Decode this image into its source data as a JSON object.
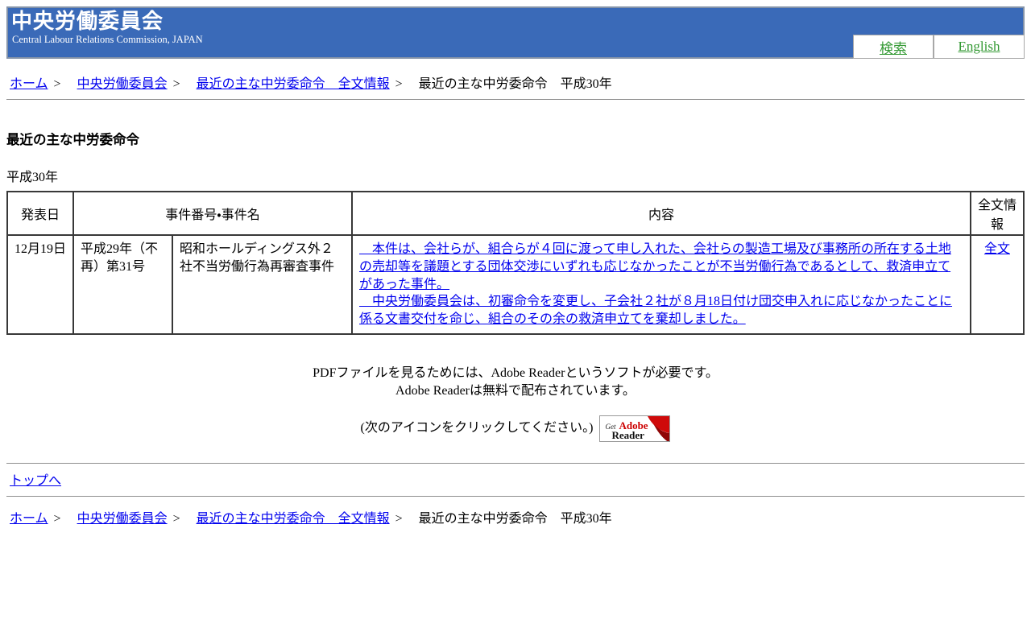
{
  "header": {
    "title": "中央労働委員会",
    "subtitle": "Central Labour Relations Commission, JAPAN",
    "search_label": "検索",
    "english_label": "English"
  },
  "breadcrumb": {
    "separator": ">",
    "items": [
      {
        "label": "ホーム"
      },
      {
        "label": "中央労働委員会"
      },
      {
        "label": "最近の主な中労委命令　全文情報"
      },
      {
        "label": "最近の主な中労委命令　平成30年"
      }
    ]
  },
  "main": {
    "page_title": "最近の主な中労委命令",
    "year_label": "平成30年",
    "table": {
      "headers": {
        "date": "発表日",
        "case": "事件番号・事件名",
        "content": "内容",
        "fulltext": "全文情報"
      },
      "row": {
        "date": "12月19日",
        "case_number": "平成29年（不再）第31号",
        "case_name": "昭和ホールディングス外２社不当労働行為再審査事件",
        "summary_para1": "　本件は、会社らが、組合らが４回に渡って申し入れた、会社らの製造工場及び事務所の所在する土地の売却等を議題とする団体交渉にいずれも応じなかったことが不当労働行為であるとして、救済申立てがあった事件。",
        "summary_para2": "　中央労働委員会は、初審命令を変更し、子会社２社が８月18日付け団交申入れに応じなかったことに係る文書交付を命じ、組合のその余の救済申立てを棄却しました。",
        "fulltext_label": "全文"
      }
    },
    "pdf_note": {
      "line1": "PDFファイルを見るためには、Adobe Readerというソフトが必要です。",
      "line2": "Adobe Readerは無料で配布されています。",
      "line3": "(次のアイコンをクリックしてください。)",
      "badge": {
        "get": "Get",
        "adobe": "Adobe",
        "reader": "Reader"
      }
    },
    "top_link": "トップへ"
  },
  "colors": {
    "banner_blue": "#3a6ab8",
    "banner_border": "#8493a8",
    "link_blue": "#0000ee",
    "green_link": "#339933",
    "adobe_red": "#cc0000",
    "table_border": "#383838"
  }
}
